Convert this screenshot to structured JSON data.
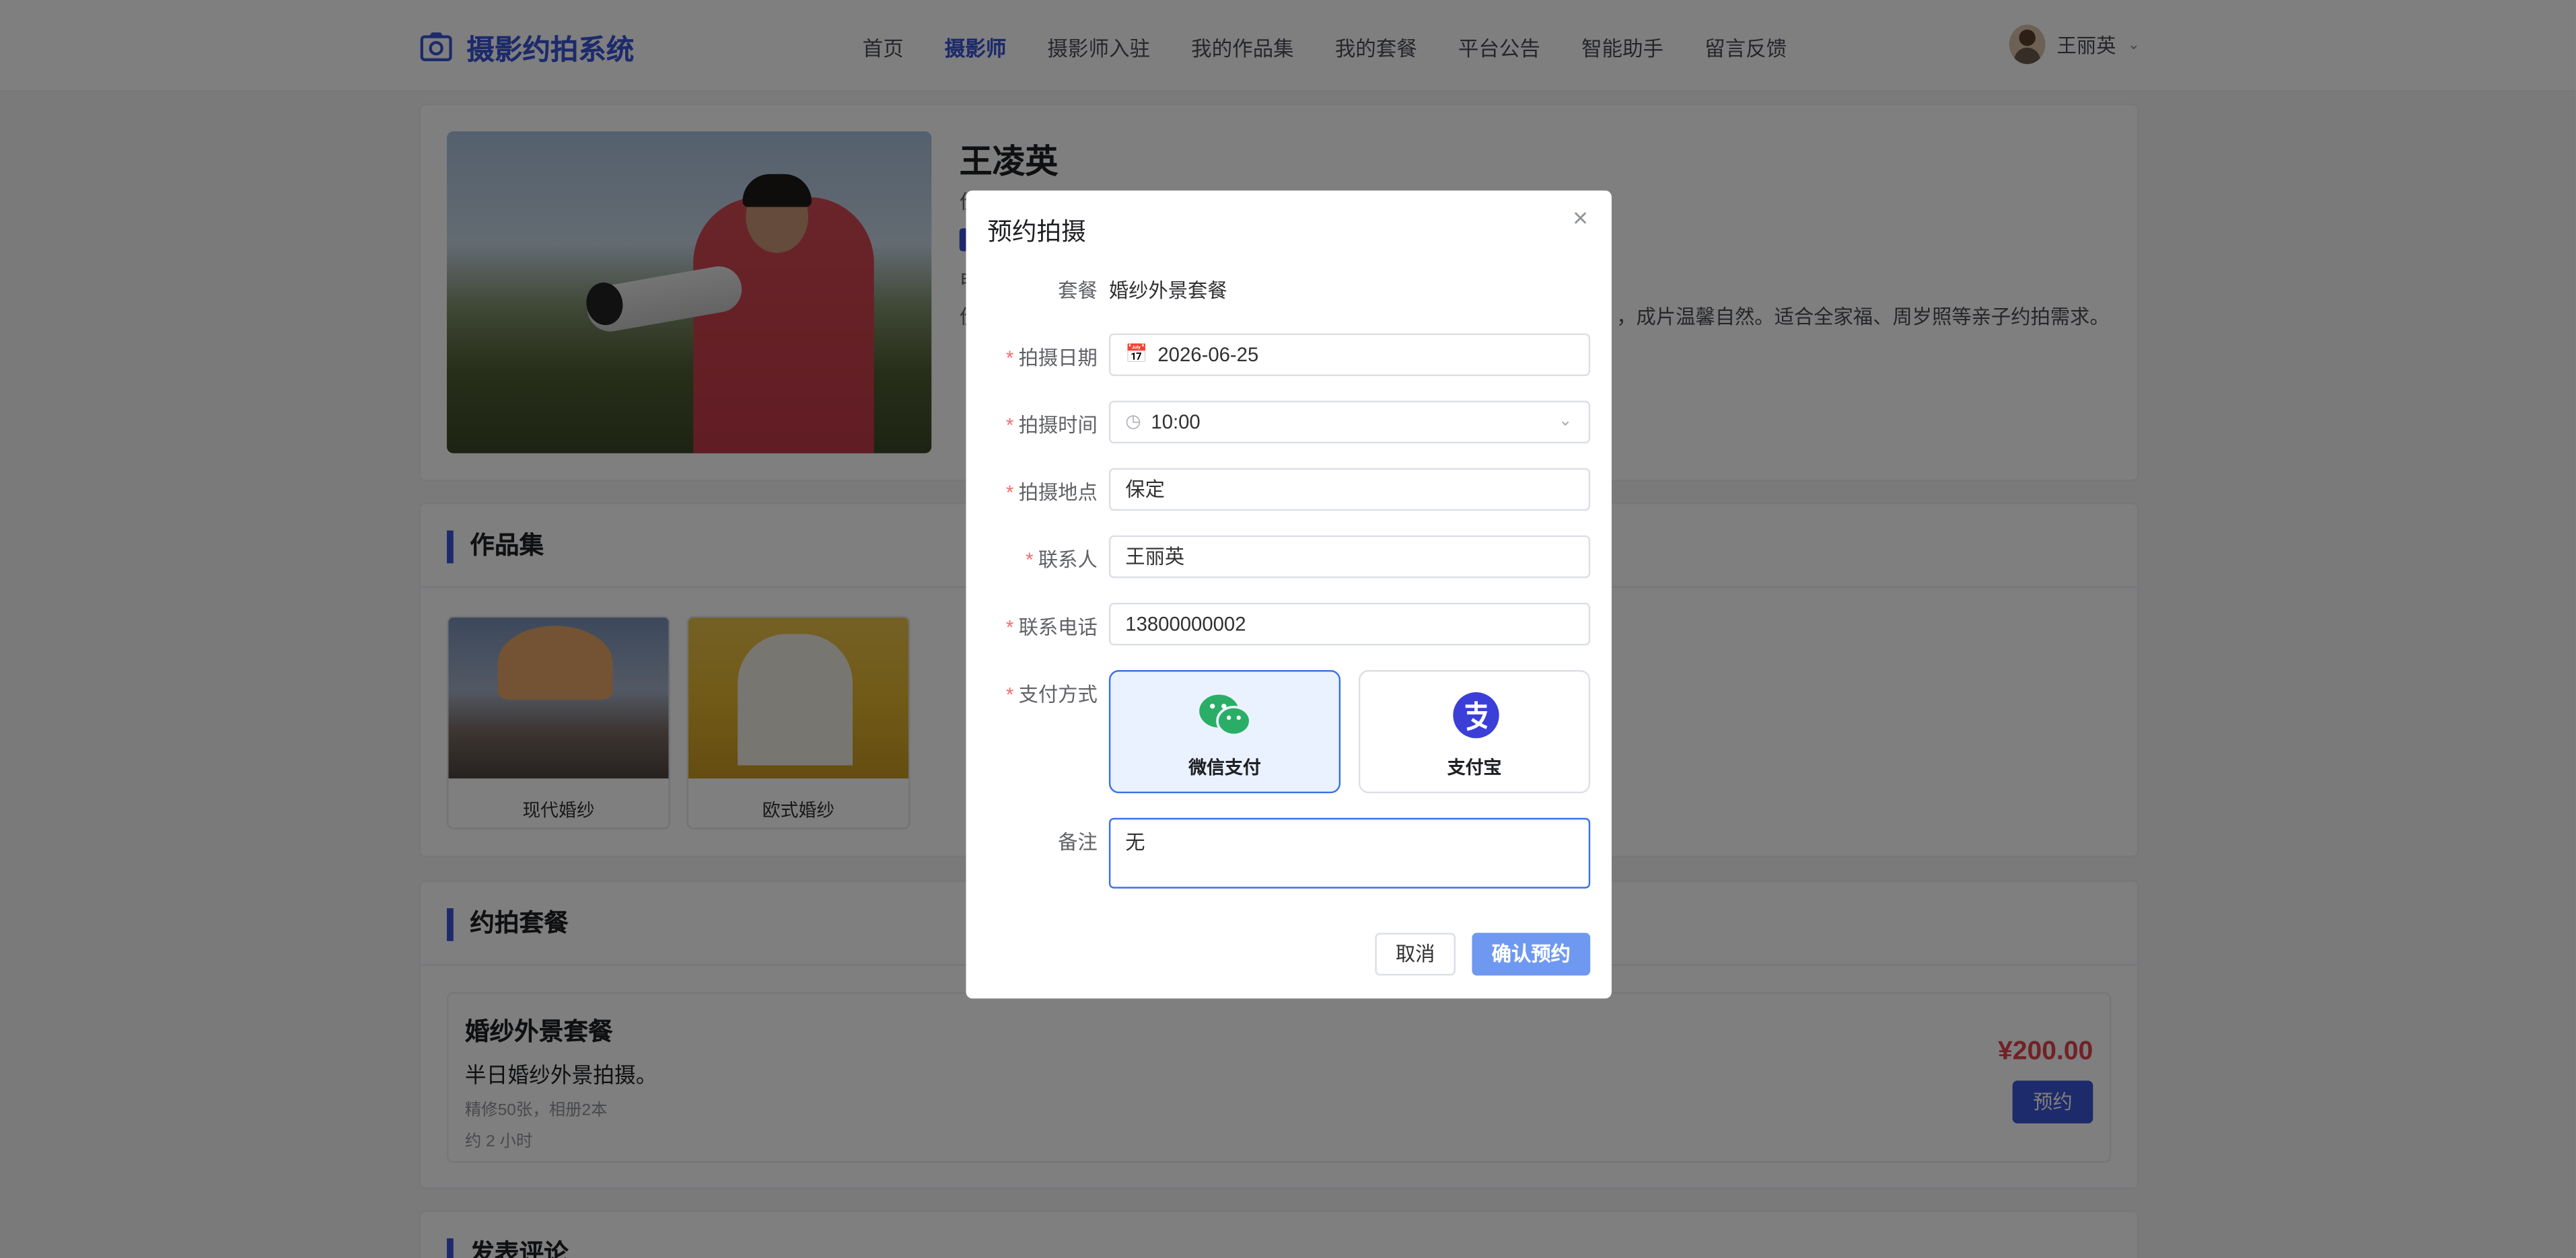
{
  "app": {
    "title": "摄影约拍系统",
    "brand_color": "#3b55d6"
  },
  "nav": {
    "items": [
      {
        "label": "首页"
      },
      {
        "label": "摄影师",
        "active": true
      },
      {
        "label": "摄影师入驻"
      },
      {
        "label": "我的作品集"
      },
      {
        "label": "我的套餐"
      },
      {
        "label": "平台公告"
      },
      {
        "label": "智能助手"
      },
      {
        "label": "留言反馈"
      }
    ]
  },
  "user": {
    "name": "王丽英"
  },
  "profile": {
    "name": "王凌英",
    "line1": "价",
    "line3": "电",
    "line4": "价",
    "desc_tail": "，成片温馨自然。适合全家福、周岁照等亲子约拍需求。"
  },
  "works": {
    "title": "作品集",
    "items": [
      {
        "caption": "现代婚纱"
      },
      {
        "caption": "欧式婚纱"
      }
    ]
  },
  "packages": {
    "title": "约拍套餐",
    "item": {
      "name": "婚纱外景套餐",
      "summary": "半日婚纱外景拍摄。",
      "detail": "精修50张，相册2本",
      "duration": "约 2 小时",
      "price": "¥200.00",
      "book_label": "预约"
    }
  },
  "reviews": {
    "title": "发表评论"
  },
  "dialog": {
    "title": "预约拍摄",
    "package_label": "套餐",
    "package_value": "婚纱外景套餐",
    "date_label": "拍摄日期",
    "date_value": "2026-06-25",
    "time_label": "拍摄时间",
    "time_value": "10:00",
    "location_label": "拍摄地点",
    "location_value": "保定",
    "contact_label": "联系人",
    "contact_value": "王丽英",
    "phone_label": "联系电话",
    "phone_value": "13800000002",
    "payment_label": "支付方式",
    "payment_options": [
      {
        "label": "微信支付",
        "selected": true,
        "color": "#2aae67"
      },
      {
        "label": "支付宝",
        "selected": false,
        "color": "#3b3fd8"
      }
    ],
    "remark_label": "备注",
    "remark_value": "无",
    "cancel_label": "取消",
    "confirm_label": "确认预约",
    "required_mark": "*"
  }
}
